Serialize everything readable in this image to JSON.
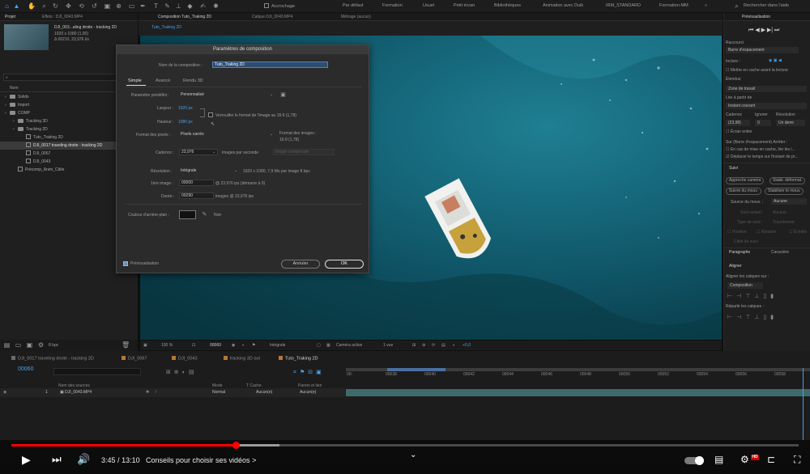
{
  "toolbar": {
    "snap_label": "Accrochage",
    "workspaces": [
      "Par défaut",
      "Formation",
      "Usuel",
      "Petit écran",
      "Bibliothèques",
      "Animation avec Duik",
      "IRM_STANDARD",
      "Formation-MM"
    ],
    "search_help": "Rechercher dans l'aide"
  },
  "project": {
    "tabs": [
      "Projet",
      "Effets : DJI_0043.MP4"
    ],
    "selected_name": "DJI_003...aling droite - tracking 2D",
    "selected_info": [
      "1920 x 1080 (1,00)",
      "Δ 00210, 23,976 i/s"
    ],
    "column_name": "Nom",
    "items": [
      {
        "label": "Solids",
        "kind": "folder",
        "depth": 0
      },
      {
        "label": "Import",
        "kind": "folder",
        "depth": 0
      },
      {
        "label": "COMP",
        "kind": "folder",
        "depth": 0
      },
      {
        "label": "Tracking 3D",
        "kind": "folder",
        "depth": 1
      },
      {
        "label": "Tracking 2D",
        "kind": "folder",
        "depth": 1
      },
      {
        "label": "Tuto_Traking 2D",
        "kind": "comp",
        "depth": 2
      },
      {
        "label": "DJI_0017 traveling droite - tracking 2D",
        "kind": "comp",
        "depth": 2,
        "selected": true
      },
      {
        "label": "DJI_0067",
        "kind": "file",
        "depth": 2
      },
      {
        "label": "DJI_0043",
        "kind": "file",
        "depth": 2
      },
      {
        "label": "Précomp_Anim_Cible",
        "kind": "comp",
        "depth": 1
      }
    ],
    "bpc": "8 bpc"
  },
  "viewer": {
    "tabs": [
      "Composition  Tuto_Traking 2D",
      "Calque  DJI_0043.MP4",
      "Métrage  (aucun)"
    ],
    "comp_breadcrumb": "Tuto_Traking 2D",
    "zoom": "100 %",
    "timecode": "00060",
    "resolution": "Intégrale",
    "camera": "Caméra active",
    "views": "1 vue",
    "exposure": "+0,0"
  },
  "dialog": {
    "title": "Paramètres de composition",
    "comp_name_label": "Nom de la composition :",
    "comp_name": "Tuto_Traking 2D",
    "tabs": [
      "Simple",
      "Avancé",
      "Rendu 3D"
    ],
    "preset_label": "Paramètre prédéfini :",
    "preset": "Personnalisé",
    "width_label": "Largeur :",
    "width": "1920 px",
    "height_label": "Hauteur :",
    "height": "1080 px",
    "lock_ratio": "Verrouiller le format de l'image au 16:9 (1,78)",
    "pixel_aspect_label": "Format des pixels :",
    "pixel_aspect": "Pixels carrés",
    "frame_aspect_label": "Format des images :",
    "frame_aspect": "16:9 (1,78)",
    "fps_label": "Cadence :",
    "fps": "23,976",
    "fps_unit": "images par seconde",
    "frame_drop": "Image compensée",
    "resolution_label": "Résolution :",
    "resolution": "Intégrale",
    "resolution_info": "1920 x 1080, 7,9 Mo par image 8 bpc",
    "start_label": "1ère image :",
    "start": "00000",
    "start_info": "@ 23,976 ips (démarre à 0)",
    "duration_label": "Durée :",
    "duration": "00290",
    "duration_info": "images @ 23,976 ips",
    "bg_label": "Couleur d'arrière-plan :",
    "bg_name": "Noir",
    "bg_color": "#111111",
    "preview": "Prévisualisation",
    "cancel": "Annuler",
    "ok": "OK"
  },
  "right_panel": {
    "title": "Prévisualisation",
    "shortcut_label": "Raccourci",
    "shortcut": "Barre d'espacement",
    "include_label": "Inclure :",
    "cache_label": "Mettre en cache avant la lecture",
    "range_label": "Étendue",
    "range": "Zone de travail",
    "play_from_label": "Lire à partir de",
    "play_from": "Instant courant",
    "frame_rate_label": "Cadence",
    "skip_label": "Ignorer",
    "res_label": "Résolution",
    "frame_rate": "(23,98)",
    "skip": "0",
    "res": "Un demi",
    "fullscreen": "Écran entier",
    "on_stop_label": "Sur (Barre d'espacement) Arrêter :",
    "on_stop_1": "En cas de mise en cache, lire les i...",
    "on_stop_2": "Déplacer le temps sur l'instant de pr...",
    "tracker_title": "Suivi",
    "tracker_buttons": [
      "Approche caméra",
      "Stabil. déformat.",
      "Suivre du mouv.",
      "Stabiliser le mouv."
    ],
    "motion_source_label": "Source du mouv. :",
    "motion_source": "Aucune",
    "current_track_label": "Suivi actuel :",
    "current_track": "Aucune",
    "track_type_label": "Type de suivi :",
    "track_type": "Transformer",
    "position": "Position",
    "rotation": "Rotation",
    "scale": "Échelle",
    "edit_target": "Cible du suivi",
    "paragraph_tab": "Paragraphe",
    "character_tab": "Caractère",
    "align_title": "Aligner",
    "align_to_label": "Aligner les calques sur :",
    "align_to": "Composition",
    "distribute_label": "Répartir les calques :"
  },
  "timeline": {
    "tabs": [
      {
        "label": "DJI_0017 traveling droite - tracking 2D",
        "color": "#6a6a6a"
      },
      {
        "label": "DJI_0067",
        "color": "#b5783a"
      },
      {
        "label": "DJI_0043",
        "color": "#b5783a"
      },
      {
        "label": "tracking 3D out",
        "color": "#b5783a"
      },
      {
        "label": "Tuto_Traking 2D",
        "color": "#b5783a",
        "active": true
      }
    ],
    "current_time": "00060",
    "ruler": [
      "00:",
      "00038",
      "00040",
      "00042",
      "00044",
      "00046",
      "00048",
      "00050",
      "00052",
      "00054",
      "00056",
      "00058"
    ],
    "col_source": "Nom des sources",
    "col_mode": "Mode",
    "col_trkmat": "T  Cache",
    "col_parent": "Parent et lien",
    "layer_num": "1",
    "layer_name": "DJI_0043.MP4",
    "layer_mode": "Normal",
    "layer_matte": "Aucun(e)",
    "layer_parent": "Aucun(e)"
  },
  "player": {
    "current": "3:45",
    "separator": "/",
    "total": "13:10",
    "chapter": "Conseils pour choisir ses vidéos",
    "chapter_arrow": ">",
    "played_fraction": 0.285,
    "hd_label": "HD"
  }
}
